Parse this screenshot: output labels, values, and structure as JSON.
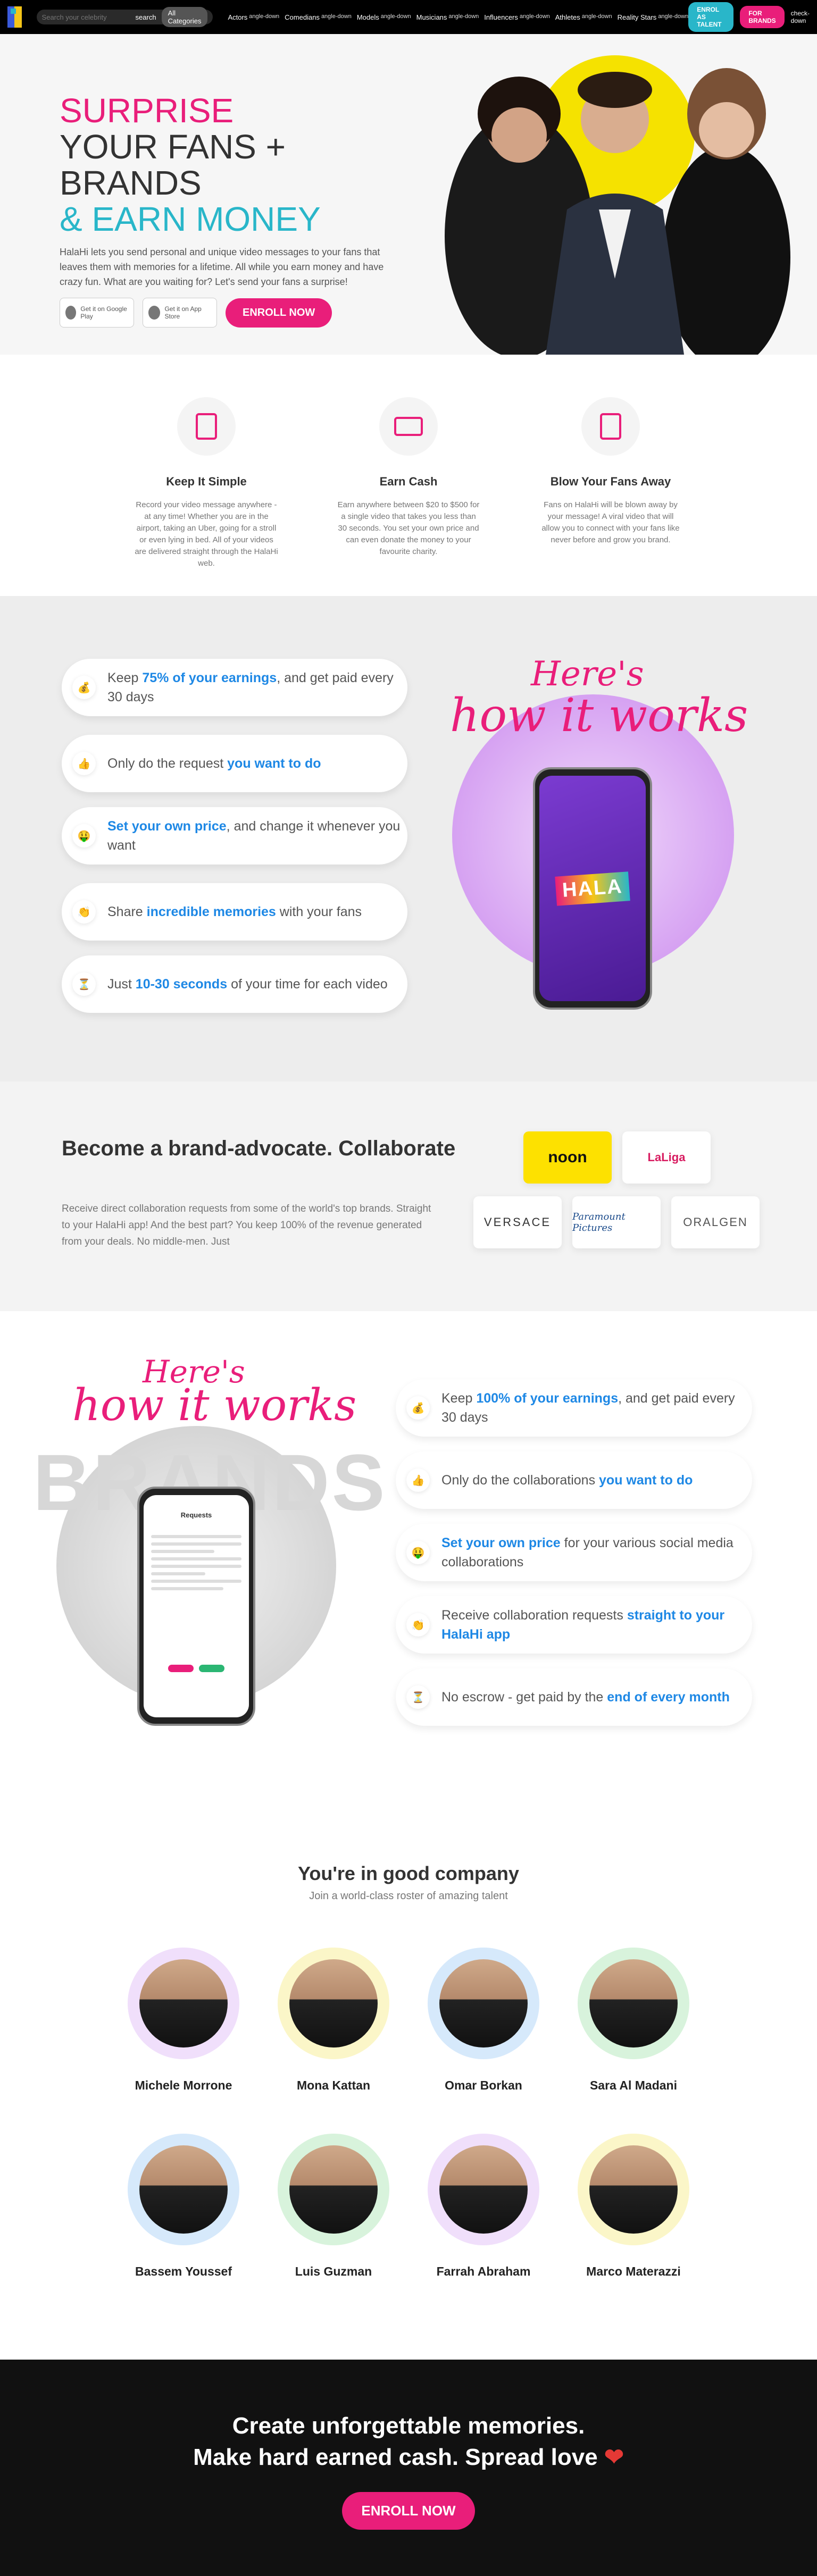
{
  "nav": {
    "search_placeholder": "Search your celebrity",
    "search_label": "search",
    "categories_button": "All Categories",
    "menu": [
      {
        "label": "Actors",
        "caret": "angle-down"
      },
      {
        "label": "Comedians",
        "caret": "angle-down"
      },
      {
        "label": "Models",
        "caret": "angle-down"
      },
      {
        "label": "Musicians",
        "caret": "angle-down"
      },
      {
        "label": "Influencers",
        "caret": "angle-down"
      },
      {
        "label": "Athletes",
        "caret": "angle-down"
      },
      {
        "label": "Reality Stars",
        "caret": "angle-down"
      }
    ],
    "enrol_talent": "ENROL AS TALENT",
    "for_brands": "FOR BRANDS",
    "for_brands_caret": "check-down"
  },
  "hero": {
    "line1": "SURPRISE",
    "line2": "YOUR FANS + BRANDS",
    "line3": "& EARN MONEY",
    "description": "HalaHi lets you send personal and unique video messages to your fans that leaves them with memories for a lifetime. All while you earn money and have crazy fun. What are you waiting for? Let's send your fans a surprise!",
    "google_play": "Get it on Google Play",
    "app_store": "Get it on App Store",
    "enroll": "ENROLL NOW"
  },
  "features": [
    {
      "title": "Keep It Simple",
      "desc": "Record your video message anywhere - at any time! Whether you are in the airport, taking an Uber, going for a stroll or even lying in bed. All of your videos are delivered straight through the HalaHi web."
    },
    {
      "title": "Earn Cash",
      "desc": "Earn anywhere between $20 to $500 for a single video that takes you less than 30 seconds. You set your own price and can even donate the money to your favourite charity."
    },
    {
      "title": "Blow Your Fans Away",
      "desc": "Fans on HalaHi will be blown away by your message! A viral video that will allow you to connect with your fans like never before and grow you brand."
    }
  ],
  "how_talent": {
    "heres": "Here's",
    "how": "how it works",
    "items": [
      {
        "emoji": "💰",
        "pre": "Keep ",
        "hl": "75% of your earnings",
        "post": ", and get paid every 30 days"
      },
      {
        "emoji": "👍",
        "pre": "Only do the request ",
        "hl": "you want to do",
        "post": ""
      },
      {
        "emoji": "🤑",
        "pre": "",
        "hl": "Set your own price",
        "post": ", and change it whenever you want"
      },
      {
        "emoji": "👏",
        "pre": "Share ",
        "hl": "incredible memories",
        "post": " with your fans"
      },
      {
        "emoji": "⏳",
        "pre": "Just ",
        "hl": "10-30 seconds",
        "post": " of your time for each video"
      }
    ],
    "phone_logo": "HALA"
  },
  "brand": {
    "title": "Become a brand-advocate. Collaborate",
    "desc": "Receive direct collaboration requests from some of the world's top brands. Straight to your HalaHi app! And the best part? You keep 100% of the revenue generated from your deals. No middle-men. Just",
    "logos": [
      "noon",
      "LaLiga",
      "VERSACE",
      "Paramount Pictures",
      "ORALGEN"
    ]
  },
  "how_brands": {
    "heres": "Here's",
    "how": "how it works",
    "watermark": "BRANDS",
    "phone_title": "Requests",
    "items": [
      {
        "emoji": "💰",
        "pre": "Keep ",
        "hl": "100% of your earnings",
        "post": ", and get paid every 30 days"
      },
      {
        "emoji": "👍",
        "pre": "Only do the collaborations ",
        "hl": "you want to do",
        "post": ""
      },
      {
        "emoji": "🤑",
        "pre": "",
        "hl": "Set your own price",
        "post": " for your various social media collaborations"
      },
      {
        "emoji": "👏",
        "pre": "Receive collaboration requests ",
        "hl": "straight to your HalaHi app",
        "post": ""
      },
      {
        "emoji": "⏳",
        "pre": "No escrow - get paid by the ",
        "hl": "end of every month",
        "post": ""
      }
    ]
  },
  "company": {
    "title": "You're in good company",
    "subtitle": "Join a world-class roster of amazing talent",
    "celebs": [
      {
        "name": "Michele Morrone",
        "ring": "#f0dffb"
      },
      {
        "name": "Mona Kattan",
        "ring": "#fbf6c8"
      },
      {
        "name": "Omar Borkan",
        "ring": "#d6e9fb"
      },
      {
        "name": "Sara Al Madani",
        "ring": "#d8f3dc"
      },
      {
        "name": "Bassem Youssef",
        "ring": "#d6e9fb"
      },
      {
        "name": "Luis Guzman",
        "ring": "#d8f3dc"
      },
      {
        "name": "Farrah Abraham",
        "ring": "#f0dffb"
      },
      {
        "name": "Marco Materazzi",
        "ring": "#fbf6c8"
      }
    ]
  },
  "cta": {
    "line1": "Create unforgettable memories.",
    "line2": "Make hard earned cash. Spread love",
    "heart": "❤",
    "button": "ENROLL NOW"
  },
  "colors": {
    "pink": "#e91e7a",
    "teal": "#29b6c9",
    "blue_highlight": "#1e88e5"
  }
}
